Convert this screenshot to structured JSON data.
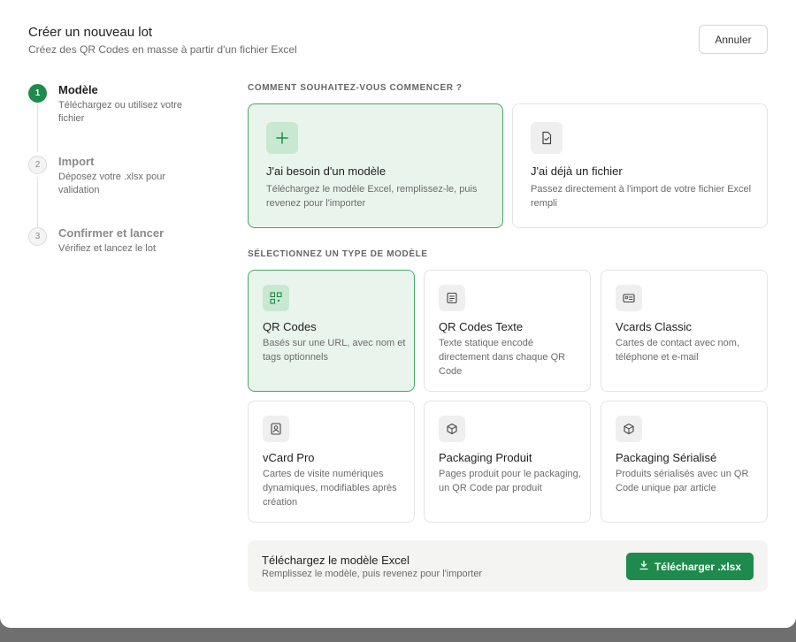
{
  "modal": {
    "title": "Créer un nouveau lot",
    "subtitle": "Créez des QR Codes en masse à partir d'un fichier Excel",
    "cancel_label": "Annuler"
  },
  "steps": [
    {
      "number": "1",
      "title": "Modèle",
      "description": "Téléchargez ou utilisez votre fichier",
      "state": "active"
    },
    {
      "number": "2",
      "title": "Import",
      "description": "Déposez votre .xlsx pour validation",
      "state": "inactive"
    },
    {
      "number": "3",
      "title": "Confirmer et lancer",
      "description": "Vérifiez et lancez le lot",
      "state": "inactive"
    }
  ],
  "start": {
    "label": "COMMENT SOUHAITEZ-VOUS COMMENCER ?",
    "options": [
      {
        "title": "J'ai besoin d'un modèle",
        "description": "Téléchargez le modèle Excel, remplissez-le, puis revenez pour l'importer",
        "icon": "plus-icon",
        "selected": true
      },
      {
        "title": "J'ai déjà un fichier",
        "description": "Passez directement à l'import de votre fichier Excel rempli",
        "icon": "file-check-icon",
        "selected": false
      }
    ]
  },
  "types": {
    "label": "SÉLECTIONNEZ UN TYPE DE MODÈLE",
    "items": [
      {
        "title": "QR Codes",
        "description": "Basés sur une URL, avec nom et tags optionnels",
        "icon": "qr-code-icon",
        "selected": true
      },
      {
        "title": "QR Codes Texte",
        "description": "Texte statique encodé directement dans chaque QR Code",
        "icon": "text-document-icon",
        "selected": false
      },
      {
        "title": "Vcards Classic",
        "description": "Cartes de contact avec nom, téléphone et e-mail",
        "icon": "contact-card-icon",
        "selected": false
      },
      {
        "title": "vCard Pro",
        "description": "Cartes de visite numériques dynamiques, modifiables après création",
        "icon": "user-badge-icon",
        "selected": false
      },
      {
        "title": "Packaging Produit",
        "description": "Pages produit pour le packaging, un QR Code par produit",
        "icon": "package-icon",
        "selected": false
      },
      {
        "title": "Packaging Sérialisé",
        "description": "Produits sérialisés avec un QR Code unique par article",
        "icon": "package-serial-icon",
        "selected": false
      }
    ]
  },
  "download": {
    "title": "Téléchargez le modèle Excel",
    "subtitle": "Remplissez le modèle, puis revenez pour l'importer",
    "button_label": "Télécharger .xlsx"
  },
  "colors": {
    "accent": "#1e8a4c",
    "selected_bg": "#e9f5ec",
    "selected_border": "#4aa56b"
  }
}
